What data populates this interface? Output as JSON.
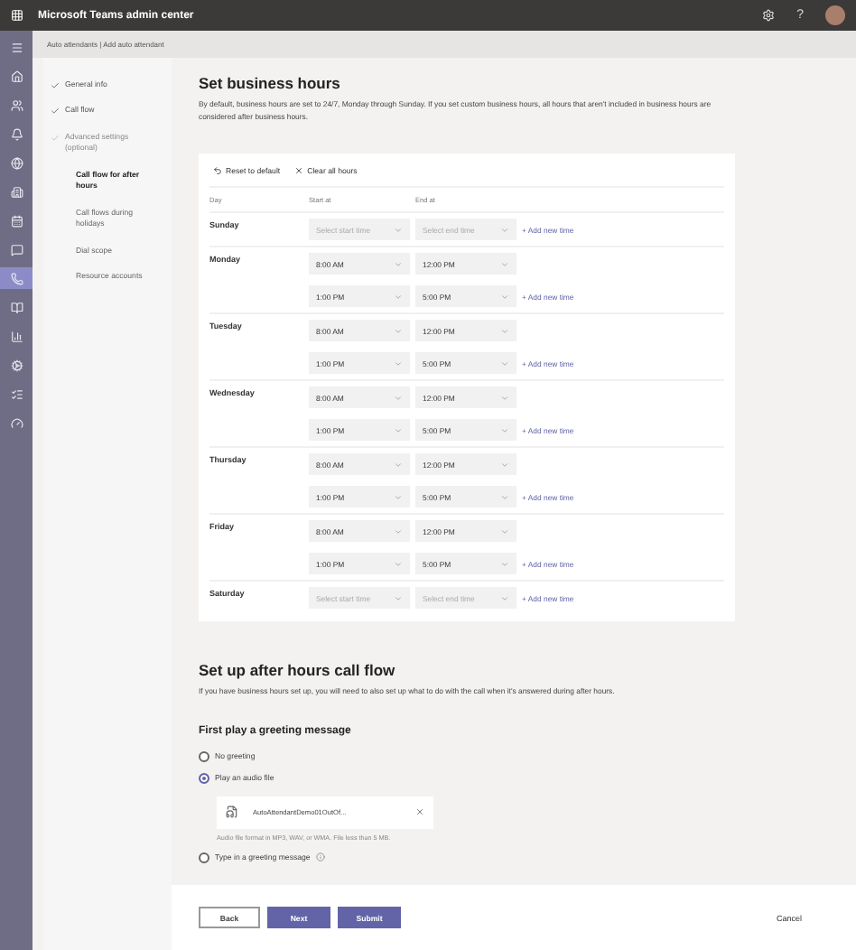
{
  "topbar": {
    "title": "Microsoft Teams admin center",
    "help": "?"
  },
  "breadcrumb": "Auto attendants | Add auto attendant",
  "steps": [
    {
      "label": "General info",
      "checked": true,
      "disabled": false
    },
    {
      "label": "Call flow",
      "checked": true,
      "disabled": false
    },
    {
      "label": "Advanced settings (optional)",
      "checked": true,
      "disabled": true,
      "children": [
        {
          "label": "Call flow for after hours",
          "selected": true
        },
        {
          "label": "Call flows during holidays",
          "selected": false
        },
        {
          "label": "Dial scope",
          "selected": false
        },
        {
          "label": "Resource accounts",
          "selected": false
        }
      ]
    }
  ],
  "business_hours": {
    "title": "Set business hours",
    "description": "By default, business hours are set to 24/7, Monday through Sunday. If you set custom business hours, all hours that aren't included in business hours are considered after business hours.",
    "toolbar": [
      {
        "kind": "reset",
        "label": "Reset to default"
      },
      {
        "kind": "clear",
        "label": "Clear all hours"
      }
    ],
    "columns": [
      "Day",
      "Start at",
      "End at"
    ],
    "days": [
      {
        "name": "Sunday",
        "add": "+ Add new time",
        "slots": [
          {
            "start_placeholder": "Select start time",
            "end_placeholder": "Select end time"
          }
        ]
      },
      {
        "name": "Monday",
        "add": "+ Add new time",
        "slots": [
          {
            "start": "8:00 AM",
            "end": "12:00 PM"
          },
          {
            "start": "1:00 PM",
            "end": "5:00 PM"
          }
        ]
      },
      {
        "name": "Tuesday",
        "add": "+ Add new time",
        "slots": [
          {
            "start": "8:00 AM",
            "end": "12:00 PM"
          },
          {
            "start": "1:00 PM",
            "end": "5:00 PM"
          }
        ]
      },
      {
        "name": "Wednesday",
        "add": "+ Add new time",
        "slots": [
          {
            "start": "8:00 AM",
            "end": "12:00 PM"
          },
          {
            "start": "1:00 PM",
            "end": "5:00 PM"
          }
        ]
      },
      {
        "name": "Thursday",
        "add": "+ Add new time",
        "slots": [
          {
            "start": "8:00 AM",
            "end": "12:00 PM"
          },
          {
            "start": "1:00 PM",
            "end": "5:00 PM"
          }
        ]
      },
      {
        "name": "Friday",
        "add": "+ Add new time",
        "slots": [
          {
            "start": "8:00 AM",
            "end": "12:00 PM"
          },
          {
            "start": "1:00 PM",
            "end": "5:00 PM"
          }
        ]
      },
      {
        "name": "Saturday",
        "add": "+ Add new time",
        "slots": [
          {
            "start_placeholder": "Select start time",
            "end_placeholder": "Select end time"
          }
        ]
      }
    ]
  },
  "after_hours": {
    "title": "Set up after hours call flow",
    "description": "If you have business hours set up, you will need to also set up what to do with the call when it's answered during after hours.",
    "greeting_title": "First play a greeting message",
    "options": [
      {
        "kind": "plain",
        "label": "No greeting",
        "selected": false
      },
      {
        "kind": "file",
        "label": "Play an audio file",
        "selected": true,
        "file_name": "AutoAttendantDemo01OutOf...",
        "hint": "Audio file format in MP3, WAV, or WMA. File less than 5 MB."
      },
      {
        "kind": "info",
        "label": "Type in a greeting message",
        "selected": false
      }
    ]
  },
  "footer": {
    "buttons": [
      {
        "kind": "secondary",
        "label": "Back"
      },
      {
        "kind": "primary",
        "label": "Next"
      },
      {
        "kind": "primary",
        "label": "Submit"
      }
    ],
    "cancel": "Cancel"
  }
}
